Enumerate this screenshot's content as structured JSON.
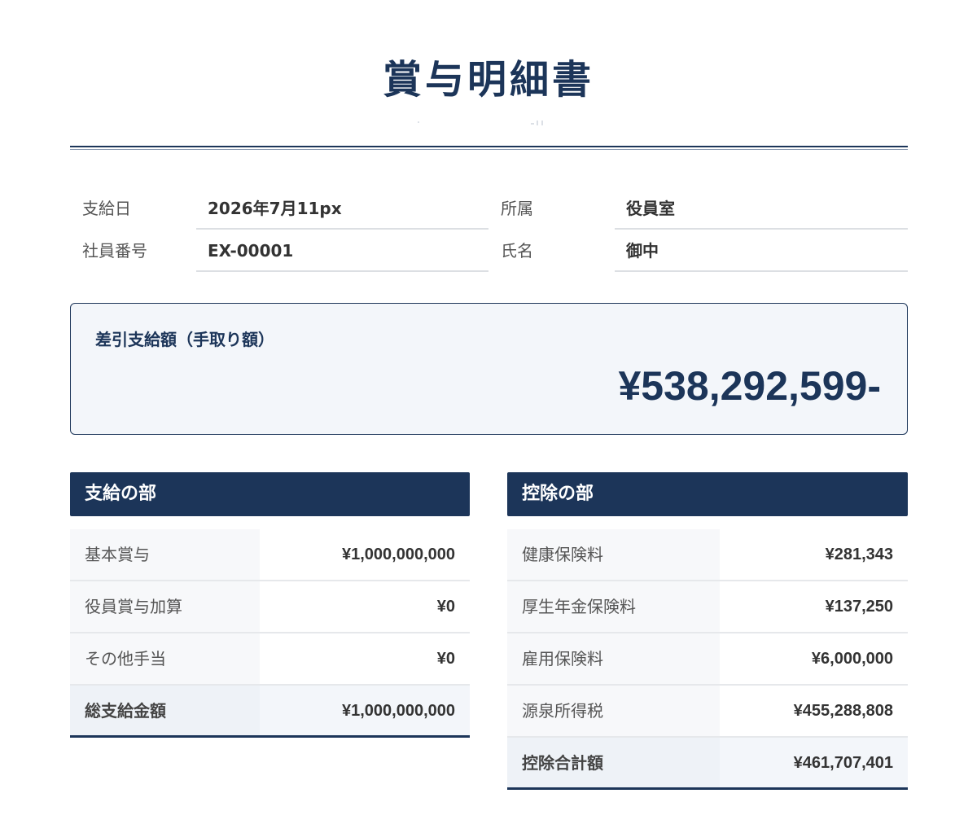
{
  "document": {
    "title": "賞与明細書"
  },
  "info": {
    "pay_date_label": "支給日",
    "pay_date_value": "2026年7月11px",
    "department_label": "所属",
    "department_value": "役員室",
    "employee_no_label": "社員番号",
    "employee_no_value": "EX-00001",
    "name_label": "氏名",
    "name_value": "御中"
  },
  "net_pay": {
    "label": "差引支給額（手取り額）",
    "amount": "¥538,292,599-"
  },
  "payments": {
    "header": "支給の部",
    "rows": [
      {
        "label": "基本賞与",
        "value": "¥1,000,000,000"
      },
      {
        "label": "役員賞与加算",
        "value": "¥0"
      },
      {
        "label": "その他手当",
        "value": "¥0"
      }
    ],
    "total": {
      "label": "総支給金額",
      "value": "¥1,000,000,000"
    }
  },
  "deductions": {
    "header": "控除の部",
    "rows": [
      {
        "label": "健康保険料",
        "value": "¥281,343"
      },
      {
        "label": "厚生年金保険料",
        "value": "¥137,250"
      },
      {
        "label": "雇用保険料",
        "value": "¥6,000,000"
      },
      {
        "label": "源泉所得税",
        "value": "¥455,288,808"
      }
    ],
    "total": {
      "label": "控除合計額",
      "value": "¥461,707,401"
    }
  },
  "colors": {
    "accent": "#1c3559",
    "panel": "#f3f6fa"
  }
}
